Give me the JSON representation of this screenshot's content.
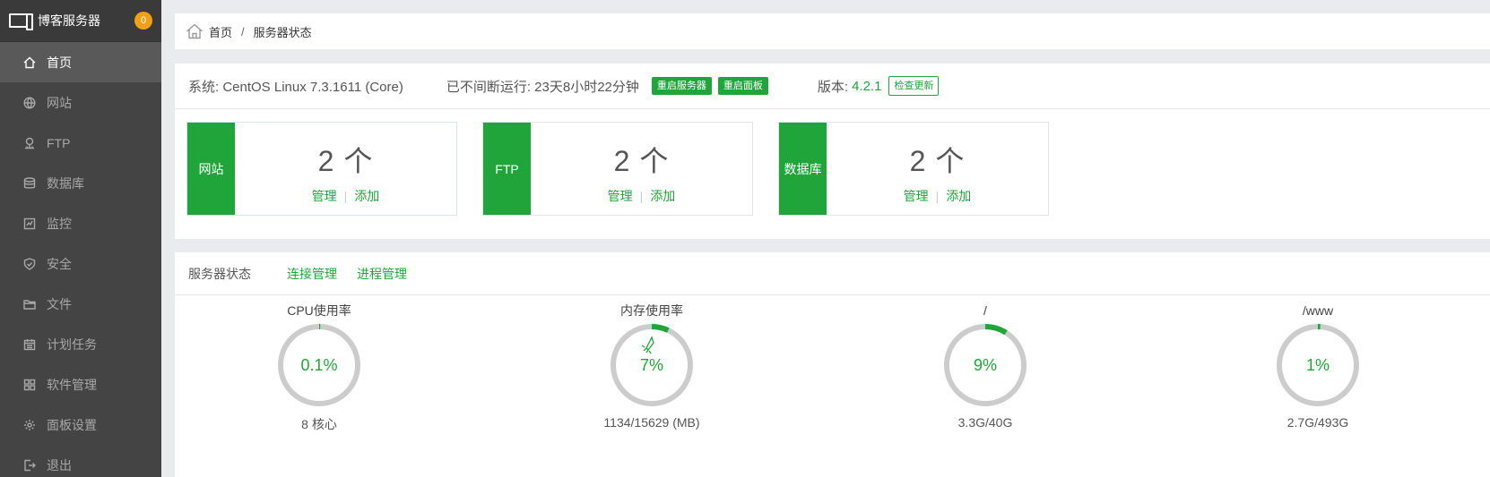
{
  "sidebar": {
    "brand": "博客服务器",
    "badge": "0",
    "items": [
      {
        "label": "首页",
        "icon": "home-icon",
        "active": true
      },
      {
        "label": "网站",
        "icon": "globe-icon"
      },
      {
        "label": "FTP",
        "icon": "ftp-icon"
      },
      {
        "label": "数据库",
        "icon": "database-icon"
      },
      {
        "label": "监控",
        "icon": "monitor-icon"
      },
      {
        "label": "安全",
        "icon": "shield-icon"
      },
      {
        "label": "文件",
        "icon": "folder-icon"
      },
      {
        "label": "计划任务",
        "icon": "calendar-icon"
      },
      {
        "label": "软件管理",
        "icon": "grid-icon"
      },
      {
        "label": "面板设置",
        "icon": "gear-icon"
      },
      {
        "label": "退出",
        "icon": "logout-icon"
      }
    ]
  },
  "breadcrumb": {
    "home": "首页",
    "sep": "/",
    "current": "服务器状态"
  },
  "info": {
    "system": "系统: CentOS Linux 7.3.1611 (Core)",
    "uptime": "已不间断运行: 23天8小时22分钟",
    "restart_server": "重启服务器",
    "restart_panel": "重启面板",
    "version_label": "版本:",
    "version": "4.2.1",
    "check_update": "检查更新"
  },
  "tiles": [
    {
      "label": "网站",
      "count": "2 个",
      "manage": "管理",
      "divider": "|",
      "add": "添加"
    },
    {
      "label": "FTP",
      "count": "2 个",
      "manage": "管理",
      "divider": "|",
      "add": "添加"
    },
    {
      "label": "数据库",
      "count": "2 个",
      "manage": "管理",
      "divider": "|",
      "add": "添加"
    }
  ],
  "status": {
    "title": "服务器状态",
    "conn_manage": "连接管理",
    "proc_manage": "进程管理",
    "gauges": [
      {
        "title": "CPU使用率",
        "value": "0.1%",
        "fraction": 0.001,
        "sub": "8 核心"
      },
      {
        "title": "内存使用率",
        "value": "7%",
        "fraction": 0.07,
        "sub": "1134/15629 (MB)",
        "rocket": true
      },
      {
        "title": "/",
        "value": "9%",
        "fraction": 0.09,
        "sub": "3.3G/40G"
      },
      {
        "title": "/www",
        "value": "1%",
        "fraction": 0.01,
        "sub": "2.7G/493G"
      }
    ]
  },
  "colors": {
    "accent": "#20a53a",
    "sidebar": "#444444",
    "badge": "#f0a014",
    "ring": "#cccccc"
  }
}
